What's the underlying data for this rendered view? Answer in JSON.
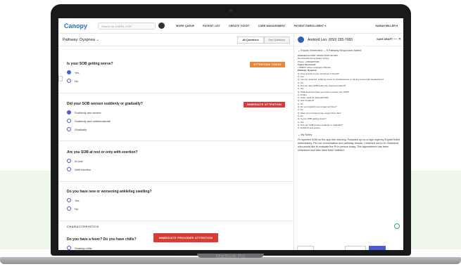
{
  "device": {
    "label": "MacBook Pro"
  },
  "nav": {
    "logo": "Canopy",
    "search_placeholder": "Search for a MRN, DOB",
    "links": [
      "WORK QUEUE",
      "PATIENT LIST",
      "CREATE TICKET",
      "CARE MANAGEMENT",
      "PATIENT ENROLLMENT ▾"
    ],
    "user": "SARAH MILLER ▾"
  },
  "pathway": {
    "title": "Pathway: Dyspnea ⌄",
    "tabs": [
      "All Questions",
      "Key Questions"
    ]
  },
  "questions": [
    {
      "title": "Is your SOB getting worse?",
      "options": [
        "Yes",
        "No"
      ],
      "selected": 0,
      "badge": "ATTENTION TODAY"
    },
    {
      "title": "Did your SOB worsen suddenly or gradually?",
      "options": [
        "Suddenly and severe",
        "Suddenly and mild/moderate",
        "Gradually"
      ],
      "selected": 0,
      "badge": "IMMEDIATE ATTENTION"
    },
    {
      "title": "Are you SOB at rest or only with exertion?",
      "options": [
        "At rest",
        "With exertion"
      ],
      "selected": -1
    },
    {
      "title": "Do you have new or worsening ankle/leg swelling?",
      "options": [
        "Yes",
        "No"
      ],
      "selected": -1
    }
  ],
  "characteristics": {
    "section": "CHARACTERISTICS",
    "title": "Do you have a fever? Do you have chills?",
    "badge": "IMMEDIATE PROVIDER ATTENTION",
    "options": [
      "Shaking chills"
    ]
  },
  "call": {
    "caller": "Android Leo: (650) 265-7083",
    "save": "SAVE DRAFT",
    "minimize": "—",
    "close": "✕",
    "expand": "⌄ Expain Generated — 5 Pathway Responses Added",
    "summary": [
      {
        "b": "Android Leo",
        "t": " MRN: 000010 DOB 1/2/1960"
      },
      {
        "b": "",
        "t": "Remote Monitoring Status: Active"
      },
      {
        "b": "",
        "t": "Phone: +16502657083"
      },
      {
        "b": "",
        "t": " "
      },
      {
        "b": "Topics Discussed",
        "t": ""
      },
      {
        "b": "",
        "t": "• DM003: Acute respiratory distress"
      },
      {
        "b": "",
        "t": " "
      },
      {
        "b": "Pathway: Dyspnea",
        "t": ""
      },
      {
        "b": "",
        "t": "Q: How recently is your shortness of breath?"
      },
      {
        "b": "",
        "t": "A: Yes"
      },
      {
        "b": "",
        "t": " "
      },
      {
        "b": "",
        "t": "Q: Are you confused, suffering a loss of consciousness, or having severe light-headedness?"
      },
      {
        "b": "",
        "t": "A: No"
      },
      {
        "b": "",
        "t": " "
      },
      {
        "b": "",
        "t": "Q: Did you have SOB before the treatment started?"
      },
      {
        "b": "",
        "t": "A: Yes"
      },
      {
        "b": "",
        "t": " "
      },
      {
        "b": "",
        "t": "Q: What treatment have you tried to reduce your SOB?"
      },
      {
        "b": "",
        "t": "A: Inhaler"
      },
      {
        "b": "",
        "t": "A: Other meds for asthma/COPD"
      },
      {
        "b": "",
        "t": " "
      },
      {
        "b": "",
        "t": "Q: Has it helped?"
      },
      {
        "b": "",
        "t": "A: No"
      },
      {
        "b": "",
        "t": " "
      },
      {
        "b": "",
        "t": "Q: Do you regularly use oxygen at home?"
      },
      {
        "b": "",
        "t": "A: No"
      },
      {
        "b": "",
        "t": " "
      },
      {
        "b": "",
        "t": "Q: Have you increased your oxygen flow rate?"
      },
      {
        "b": "",
        "t": "A: No"
      },
      {
        "b": "",
        "t": " "
      },
      {
        "b": "",
        "t": "Q: Is your SOB getting worse?"
      },
      {
        "b": "",
        "t": "A: Yes"
      },
      {
        "b": "",
        "t": " "
      },
      {
        "b": "",
        "t": "Q: Did your SOB worsen suddenly or gradually?"
      },
      {
        "b": "",
        "t": "A: Suddenly and severe"
      }
    ],
    "notes_label": "⌄ My Notes",
    "notes": "Pt reported SOB on the app this morning. Followed up on a high urgency Expain ticket immediately. Per our conversation and pathway results, I reached out to Dr. Brantford who would like to evaluate the Pt in person today. The appointment has been scheduled and labs have been ordered."
  },
  "colors": {
    "primary": "#4a5bd4",
    "orange": "#e8873a",
    "red": "#d93b36",
    "brand": "#2a6fb0"
  }
}
